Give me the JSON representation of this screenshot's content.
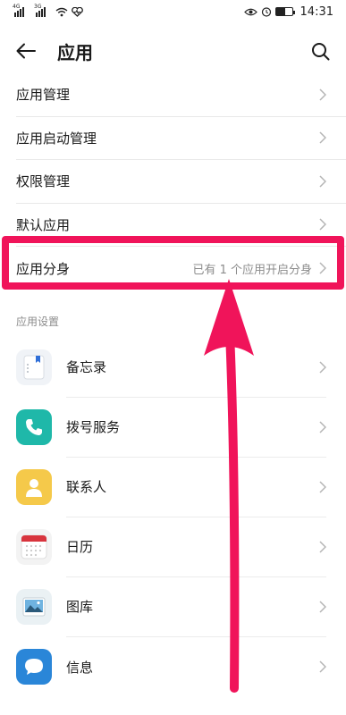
{
  "status_bar": {
    "signal1_label": "4G",
    "signal2_label": "3G",
    "time": "14:31"
  },
  "header": {
    "title": "应用"
  },
  "menu": [
    {
      "label": "应用管理"
    },
    {
      "label": "应用启动管理"
    },
    {
      "label": "权限管理"
    },
    {
      "label": "默认应用"
    },
    {
      "label": "应用分身",
      "hint": "已有 1 个应用开启分身"
    }
  ],
  "section_title": "应用设置",
  "apps": [
    {
      "label": "备忘录",
      "icon": "memo-icon"
    },
    {
      "label": "拨号服务",
      "icon": "phone-icon"
    },
    {
      "label": "联系人",
      "icon": "contacts-icon"
    },
    {
      "label": "日历",
      "icon": "calendar-icon"
    },
    {
      "label": "图库",
      "icon": "gallery-icon"
    },
    {
      "label": "信息",
      "icon": "message-icon"
    }
  ],
  "colors": {
    "highlight": "#f0145a",
    "phone_icon_bg": "#1fb8a9",
    "contacts_icon_bg": "#f5c94a",
    "message_icon_bg": "#2a86d8"
  }
}
